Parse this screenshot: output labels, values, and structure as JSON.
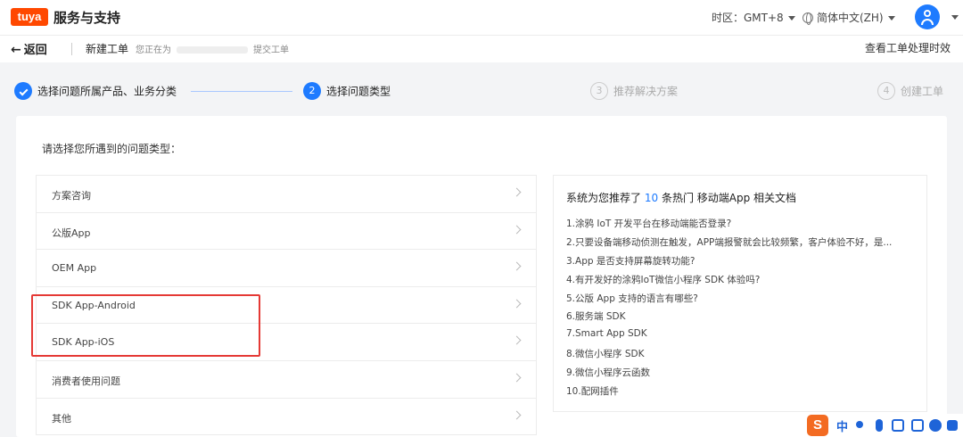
{
  "header": {
    "logo_text": "tuya",
    "title": "服务与支持",
    "timezone": "时区：GMT+8",
    "language": "简体中文(ZH)"
  },
  "subheader": {
    "back_label": "返回",
    "new_ticket": "新建工单",
    "submitting_prefix": "您正在为",
    "submitting_suffix": "提交工单",
    "view_timeliness": "查看工单处理时效"
  },
  "steps": [
    {
      "index": "1",
      "label": "选择问题所属产品、业务分类",
      "state": "done"
    },
    {
      "index": "2",
      "label": "选择问题类型",
      "state": "active"
    },
    {
      "index": "3",
      "label": "推荐解决方案",
      "state": "todo"
    },
    {
      "index": "4",
      "label": "创建工单",
      "state": "todo"
    }
  ],
  "main": {
    "prompt": "请选择您所遇到的问题类型：",
    "types": [
      {
        "label": "方案咨询"
      },
      {
        "label": "公版App"
      },
      {
        "label": "OEM App"
      },
      {
        "label": "SDK App-Android"
      },
      {
        "label": "SDK App-iOS"
      },
      {
        "label": "消费者使用问题"
      },
      {
        "label": "其他"
      }
    ]
  },
  "recommend": {
    "title_prefix": "系统为您推荐了",
    "count": "10",
    "title_suffix": "条热门 移动端App 相关文档",
    "items": [
      "1.涂鸦 IoT 开发平台在移动端能否登录?",
      "2.只要设备端移动侦测在触发，APP端报警就会比较频繁，客户体验不好，是...",
      "3.App 是否支持屏幕旋转功能?",
      "4.有开发好的涂鸦IoT微信小程序 SDK 体验吗?",
      "5.公版 App 支持的语言有哪些?",
      "6.服务端 SDK",
      "7.Smart App SDK",
      "8.微信小程序 SDK",
      "9.微信小程序云函数",
      "10.配网插件"
    ]
  },
  "ime": {
    "logo": "S",
    "mode": "中"
  },
  "colors": {
    "accent": "#1e7bff",
    "brand": "#ff4800",
    "highlight": "#e53935"
  }
}
